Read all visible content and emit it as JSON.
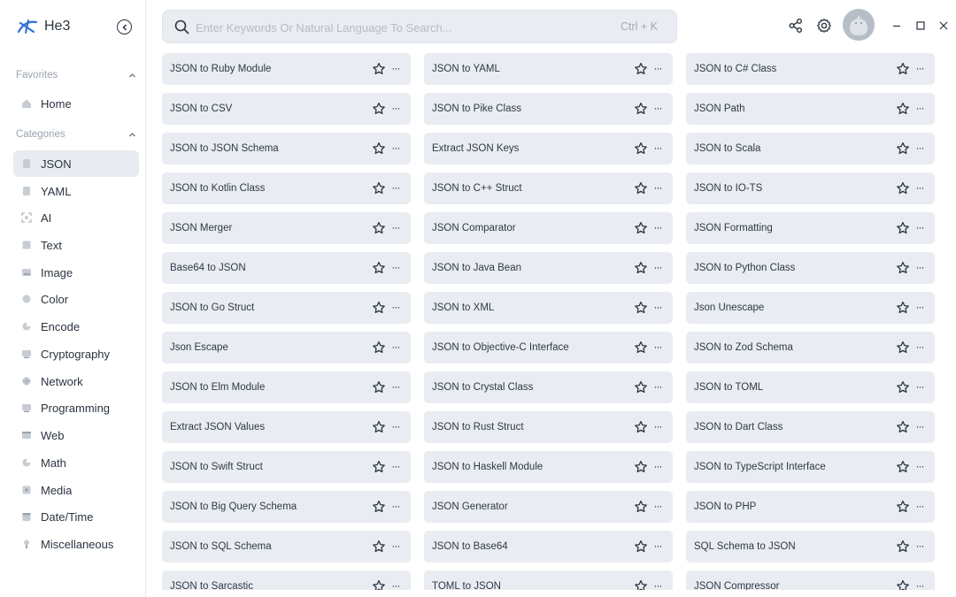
{
  "app": {
    "name": "He3"
  },
  "sidebar": {
    "favorites_label": "Favorites",
    "categories_label": "Categories",
    "favorites": [
      {
        "label": "Home",
        "icon": "home-icon"
      }
    ],
    "categories": [
      {
        "label": "JSON",
        "icon": "json-icon",
        "active": true
      },
      {
        "label": "YAML",
        "icon": "yaml-icon"
      },
      {
        "label": "AI",
        "icon": "ai-icon"
      },
      {
        "label": "Text",
        "icon": "text-icon"
      },
      {
        "label": "Image",
        "icon": "image-icon"
      },
      {
        "label": "Color",
        "icon": "color-icon"
      },
      {
        "label": "Encode",
        "icon": "encode-icon"
      },
      {
        "label": "Cryptography",
        "icon": "cryptography-icon"
      },
      {
        "label": "Network",
        "icon": "network-icon"
      },
      {
        "label": "Programming",
        "icon": "programming-icon"
      },
      {
        "label": "Web",
        "icon": "web-icon"
      },
      {
        "label": "Math",
        "icon": "math-icon"
      },
      {
        "label": "Media",
        "icon": "media-icon"
      },
      {
        "label": "Date/Time",
        "icon": "datetime-icon"
      },
      {
        "label": "Miscellaneous",
        "icon": "miscellaneous-icon"
      }
    ]
  },
  "search": {
    "placeholder": "Enter Keywords Or Natural Language To Search...",
    "value": "",
    "shortcut": "Ctrl + K"
  },
  "tools": {
    "columns": [
      [
        "JSON to Ruby Module",
        "JSON to CSV",
        "JSON to JSON Schema",
        "JSON to Kotlin Class",
        "JSON Merger",
        "Base64 to JSON",
        "JSON to Go Struct",
        "Json Escape",
        "JSON to Elm Module",
        "Extract JSON Values",
        "JSON to Swift Struct",
        "JSON to Big Query Schema",
        "JSON to SQL Schema",
        "JSON to Sarcastic"
      ],
      [
        "JSON to YAML",
        "JSON to Pike Class",
        "Extract JSON Keys",
        "JSON to C++ Struct",
        "JSON Comparator",
        "JSON to Java Bean",
        "JSON to XML",
        "JSON to Objective-C Interface",
        "JSON to Crystal Class",
        "JSON to Rust Struct",
        "JSON to Haskell Module",
        "JSON Generator",
        "JSON to Base64",
        "TOML to JSON"
      ],
      [
        "JSON to C# Class",
        "JSON Path",
        "JSON to Scala",
        "JSON to IO-TS",
        "JSON Formatting",
        "JSON to Python Class",
        "Json Unescape",
        "JSON to Zod Schema",
        "JSON to TOML",
        "JSON to Dart Class",
        "JSON to TypeScript Interface",
        "JSON to PHP",
        "SQL Schema to JSON",
        "JSON Compressor"
      ]
    ]
  },
  "colors": {
    "accent": "#2f6fd6",
    "card_bg": "#e9edf2",
    "active_nav": "#e8ecf1"
  }
}
